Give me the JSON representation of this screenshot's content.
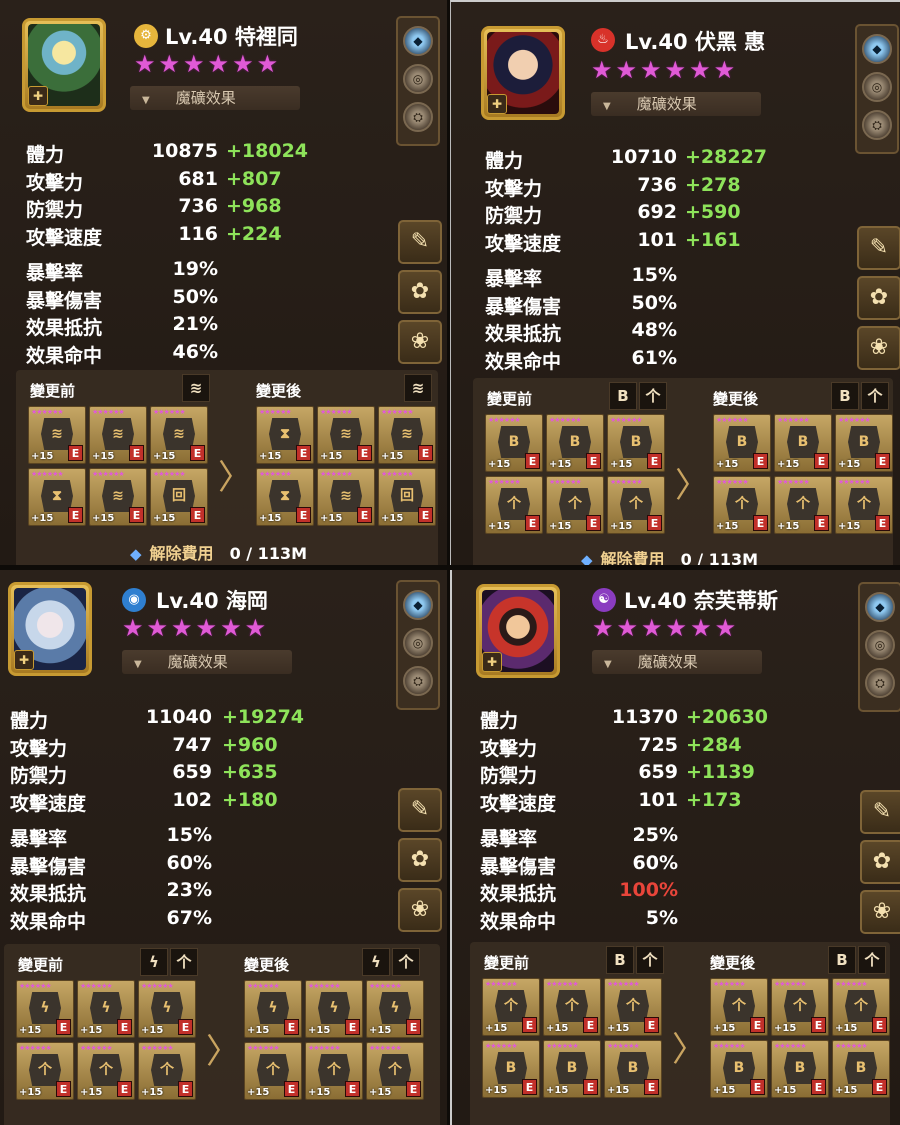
{
  "sidebar_icons": [
    "gem-icon",
    "crafted-rune-icon",
    "grindstone-icon"
  ],
  "side_tools": [
    {
      "icon": "pencil-gear-icon",
      "glyph": "✎"
    },
    {
      "icon": "skill-flower-icon",
      "glyph": "✿"
    },
    {
      "icon": "flower-remove-icon",
      "glyph": "❀"
    }
  ],
  "monsters": [
    {
      "level": "Lv.40",
      "name": "特裡同",
      "element": "wind",
      "element_color": "#e6b53c",
      "element_glyph": "⚙",
      "stars": 6,
      "rune_effect_label": "魔礦效果",
      "stats": [
        {
          "label": "體力",
          "value": "10875",
          "bonus": "+18024"
        },
        {
          "label": "攻擊力",
          "value": "681",
          "bonus": "+807"
        },
        {
          "label": "防禦力",
          "value": "736",
          "bonus": "+968"
        },
        {
          "label": "攻擊速度",
          "value": "116",
          "bonus": "+224"
        }
      ],
      "substats": [
        {
          "label": "暴擊率",
          "value": "19%"
        },
        {
          "label": "暴擊傷害",
          "value": "50%"
        },
        {
          "label": "效果抵抗",
          "value": "21%"
        },
        {
          "label": "效果命中",
          "value": "46%"
        }
      ],
      "before_label": "變更前",
      "after_label": "變更後",
      "before_sets": [
        "≋"
      ],
      "after_sets": [
        "≋"
      ],
      "before_runes": [
        {
          "glyph": "≋",
          "level": "+15",
          "grade": "E"
        },
        {
          "glyph": "≋",
          "level": "+15",
          "grade": "E"
        },
        {
          "glyph": "≋",
          "level": "+15",
          "grade": "E"
        },
        {
          "glyph": "⧗",
          "level": "+15",
          "grade": "E"
        },
        {
          "glyph": "≋",
          "level": "+15",
          "grade": "E"
        },
        {
          "glyph": "回",
          "level": "+15",
          "grade": "E"
        }
      ],
      "after_runes": [
        {
          "glyph": "⧗",
          "level": "+15",
          "grade": "E"
        },
        {
          "glyph": "≋",
          "level": "+15",
          "grade": "E"
        },
        {
          "glyph": "≋",
          "level": "+15",
          "grade": "E"
        },
        {
          "glyph": "⧗",
          "level": "+15",
          "grade": "E"
        },
        {
          "glyph": "≋",
          "level": "+15",
          "grade": "E"
        },
        {
          "glyph": "回",
          "level": "+15",
          "grade": "E"
        }
      ],
      "fee_label": "解除費用",
      "fee_value": "0 / 113M"
    },
    {
      "level": "Lv.40",
      "name": "伏黑 惠",
      "element": "fire",
      "element_color": "#d8322a",
      "element_glyph": "♨",
      "stars": 6,
      "rune_effect_label": "魔礦效果",
      "stats": [
        {
          "label": "體力",
          "value": "10710",
          "bonus": "+28227"
        },
        {
          "label": "攻擊力",
          "value": "736",
          "bonus": "+278"
        },
        {
          "label": "防禦力",
          "value": "692",
          "bonus": "+590"
        },
        {
          "label": "攻擊速度",
          "value": "101",
          "bonus": "+161"
        }
      ],
      "substats": [
        {
          "label": "暴擊率",
          "value": "15%"
        },
        {
          "label": "暴擊傷害",
          "value": "50%"
        },
        {
          "label": "效果抵抗",
          "value": "48%"
        },
        {
          "label": "效果命中",
          "value": "61%"
        }
      ],
      "before_label": "變更前",
      "after_label": "變更後",
      "before_sets": [
        "B",
        "个"
      ],
      "after_sets": [
        "B",
        "个"
      ],
      "before_runes": [
        {
          "glyph": "B",
          "level": "+15",
          "grade": "E"
        },
        {
          "glyph": "B",
          "level": "+15",
          "grade": "E"
        },
        {
          "glyph": "B",
          "level": "+15",
          "grade": "E"
        },
        {
          "glyph": "个",
          "level": "+15",
          "grade": "E"
        },
        {
          "glyph": "个",
          "level": "+15",
          "grade": "E"
        },
        {
          "glyph": "个",
          "level": "+15",
          "grade": "E"
        }
      ],
      "after_runes": [
        {
          "glyph": "B",
          "level": "+15",
          "grade": "E"
        },
        {
          "glyph": "B",
          "level": "+15",
          "grade": "E"
        },
        {
          "glyph": "B",
          "level": "+15",
          "grade": "E"
        },
        {
          "glyph": "个",
          "level": "+15",
          "grade": "E"
        },
        {
          "glyph": "个",
          "level": "+15",
          "grade": "E"
        },
        {
          "glyph": "个",
          "level": "+15",
          "grade": "E"
        }
      ],
      "fee_label": "解除費用",
      "fee_value": "0 / 113M"
    },
    {
      "level": "Lv.40",
      "name": "海岡",
      "element": "water",
      "element_color": "#2f7fd0",
      "element_glyph": "◉",
      "stars": 6,
      "rune_effect_label": "魔礦效果",
      "stats": [
        {
          "label": "體力",
          "value": "11040",
          "bonus": "+19274"
        },
        {
          "label": "攻擊力",
          "value": "747",
          "bonus": "+960"
        },
        {
          "label": "防禦力",
          "value": "659",
          "bonus": "+635"
        },
        {
          "label": "攻擊速度",
          "value": "102",
          "bonus": "+180"
        }
      ],
      "substats": [
        {
          "label": "暴擊率",
          "value": "15%"
        },
        {
          "label": "暴擊傷害",
          "value": "60%"
        },
        {
          "label": "效果抵抗",
          "value": "23%"
        },
        {
          "label": "效果命中",
          "value": "67%"
        }
      ],
      "before_label": "變更前",
      "after_label": "變更後",
      "before_sets": [
        "ϟ",
        "个"
      ],
      "after_sets": [
        "ϟ",
        "个"
      ],
      "before_runes": [
        {
          "glyph": "ϟ",
          "level": "+15",
          "grade": "E"
        },
        {
          "glyph": "ϟ",
          "level": "+15",
          "grade": "E"
        },
        {
          "glyph": "ϟ",
          "level": "+15",
          "grade": "E"
        },
        {
          "glyph": "个",
          "level": "+15",
          "grade": "E"
        },
        {
          "glyph": "个",
          "level": "+15",
          "grade": "E"
        },
        {
          "glyph": "个",
          "level": "+15",
          "grade": "E"
        }
      ],
      "after_runes": [
        {
          "glyph": "ϟ",
          "level": "+15",
          "grade": "E"
        },
        {
          "glyph": "ϟ",
          "level": "+15",
          "grade": "E"
        },
        {
          "glyph": "ϟ",
          "level": "+15",
          "grade": "E"
        },
        {
          "glyph": "个",
          "level": "+15",
          "grade": "E"
        },
        {
          "glyph": "个",
          "level": "+15",
          "grade": "E"
        },
        {
          "glyph": "个",
          "level": "+15",
          "grade": "E"
        }
      ],
      "fee_label": "",
      "fee_value": ""
    },
    {
      "level": "Lv.40",
      "name": "奈芙蒂斯",
      "element": "dark",
      "element_color": "#8a3cc0",
      "element_glyph": "☯",
      "stars": 6,
      "rune_effect_label": "魔礦效果",
      "stats": [
        {
          "label": "體力",
          "value": "11370",
          "bonus": "+20630"
        },
        {
          "label": "攻擊力",
          "value": "725",
          "bonus": "+284"
        },
        {
          "label": "防禦力",
          "value": "659",
          "bonus": "+1139"
        },
        {
          "label": "攻擊速度",
          "value": "101",
          "bonus": "+173"
        }
      ],
      "substats": [
        {
          "label": "暴擊率",
          "value": "25%"
        },
        {
          "label": "暴擊傷害",
          "value": "60%"
        },
        {
          "label": "效果抵抗",
          "value": "100%",
          "color": "#e8453a"
        },
        {
          "label": "效果命中",
          "value": "5%"
        }
      ],
      "before_label": "變更前",
      "after_label": "變更後",
      "before_sets": [
        "B",
        "个"
      ],
      "after_sets": [
        "B",
        "个"
      ],
      "before_runes": [
        {
          "glyph": "个",
          "level": "+15",
          "grade": "E"
        },
        {
          "glyph": "个",
          "level": "+15",
          "grade": "E"
        },
        {
          "glyph": "个",
          "level": "+15",
          "grade": "E"
        },
        {
          "glyph": "B",
          "level": "+15",
          "grade": "E"
        },
        {
          "glyph": "B",
          "level": "+15",
          "grade": "E"
        },
        {
          "glyph": "B",
          "level": "+15",
          "grade": "E"
        }
      ],
      "after_runes": [
        {
          "glyph": "个",
          "level": "+15",
          "grade": "E"
        },
        {
          "glyph": "个",
          "level": "+15",
          "grade": "E"
        },
        {
          "glyph": "个",
          "level": "+15",
          "grade": "E"
        },
        {
          "glyph": "B",
          "level": "+15",
          "grade": "E"
        },
        {
          "glyph": "B",
          "level": "+15",
          "grade": "E"
        },
        {
          "glyph": "B",
          "level": "+15",
          "grade": "E"
        }
      ],
      "fee_label": "",
      "fee_value": ""
    }
  ],
  "colors": {
    "bonus": "#8ee35a",
    "star": "#e05ad6",
    "frame_gold": "#c79a32"
  }
}
